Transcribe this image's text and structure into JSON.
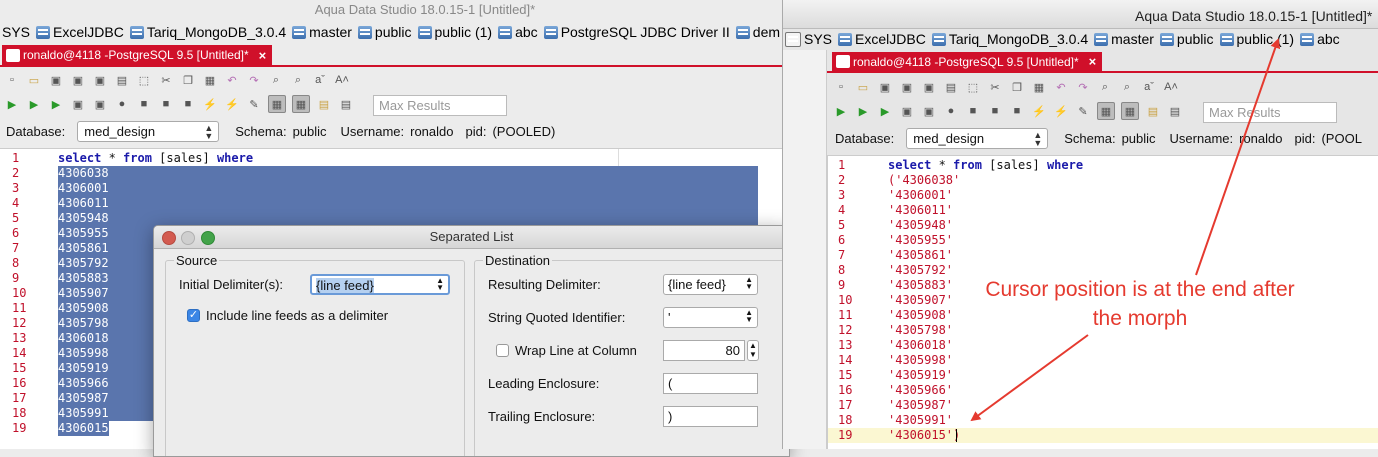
{
  "left": {
    "window_title": "Aqua Data Studio 18.0.15-1 [Untitled]*",
    "connections": [
      {
        "label": "SYS",
        "icon": "none"
      },
      {
        "label": "ExcelJDBC",
        "icon": "database-icon"
      },
      {
        "label": "Tariq_MongoDB_3.0.4",
        "icon": "database-icon"
      },
      {
        "label": "master",
        "icon": "database-icon"
      },
      {
        "label": "public",
        "icon": "database-icon"
      },
      {
        "label": "public (1)",
        "icon": "database-icon"
      },
      {
        "label": "abc",
        "icon": "database-icon"
      },
      {
        "label": "PostgreSQL JDBC Driver II",
        "icon": "database-icon"
      },
      {
        "label": "dem",
        "icon": "database-icon"
      }
    ],
    "editor_tab": "ronaldo@4118 -PostgreSQL 9.5 [Untitled]*",
    "max_results_placeholder": "Max Results",
    "database_label": "Database:",
    "database_value": "med_design",
    "schema_label": "Schema:",
    "schema_value": "public",
    "username_label": "Username:",
    "username_value": "ronaldo",
    "pid_label": "pid:",
    "pid_value": "(POOLED)",
    "lines": [
      {
        "n": "1",
        "text": "select * from [sales] where"
      },
      {
        "n": "2",
        "text": "4306038"
      },
      {
        "n": "3",
        "text": "4306001"
      },
      {
        "n": "4",
        "text": "4306011"
      },
      {
        "n": "5",
        "text": "4305948"
      },
      {
        "n": "6",
        "text": "4305955"
      },
      {
        "n": "7",
        "text": "4305861"
      },
      {
        "n": "8",
        "text": "4305792"
      },
      {
        "n": "9",
        "text": "4305883"
      },
      {
        "n": "10",
        "text": "4305907"
      },
      {
        "n": "11",
        "text": "4305908"
      },
      {
        "n": "12",
        "text": "4305798"
      },
      {
        "n": "13",
        "text": "4306018"
      },
      {
        "n": "14",
        "text": "4305998"
      },
      {
        "n": "15",
        "text": "4305919"
      },
      {
        "n": "16",
        "text": "4305966"
      },
      {
        "n": "17",
        "text": "4305987"
      },
      {
        "n": "18",
        "text": "4305991"
      },
      {
        "n": "19",
        "text": "4306015"
      }
    ]
  },
  "dialog": {
    "title": "Separated List",
    "source_label": "Source",
    "initial_delimiter_label": "Initial Delimiter(s):",
    "initial_delimiter_value": "{line feed}",
    "include_line_feeds_label": "Include line feeds as a delimiter",
    "include_line_feeds_checked": true,
    "destination_label": "Destination",
    "resulting_delimiter_label": "Resulting Delimiter:",
    "resulting_delimiter_value": "{line feed}",
    "string_quoted_label": "String Quoted Identifier:",
    "string_quoted_value": "'",
    "wrap_line_label": "Wrap Line at Column",
    "wrap_line_checked": false,
    "wrap_line_value": "80",
    "leading_enclosure_label": "Leading Enclosure:",
    "leading_enclosure_value": "(",
    "trailing_enclosure_label": "Trailing Enclosure:",
    "trailing_enclosure_value": ")"
  },
  "right": {
    "window_title": "Aqua Data Studio 18.0.15-1 [Untitled]*",
    "connections": [
      {
        "label": "SYS",
        "icon": "none"
      },
      {
        "label": "ExcelJDBC",
        "icon": "database-icon"
      },
      {
        "label": "Tariq_MongoDB_3.0.4",
        "icon": "database-icon"
      },
      {
        "label": "master",
        "icon": "database-icon"
      },
      {
        "label": "public",
        "icon": "database-icon"
      },
      {
        "label": "public (1)",
        "icon": "database-icon"
      },
      {
        "label": "abc",
        "icon": "database-icon"
      }
    ],
    "editor_tab": "ronaldo@4118 -PostgreSQL 9.5 [Untitled]*",
    "max_results_placeholder": "Max Results",
    "database_label": "Database:",
    "database_value": "med_design",
    "schema_label": "Schema:",
    "schema_value": "public",
    "username_label": "Username:",
    "username_value": "ronaldo",
    "pid_label": "pid:",
    "pid_value": "(POOL",
    "lines": [
      {
        "n": "1",
        "text": "select * from [sales] where"
      },
      {
        "n": "2",
        "text": "('4306038'"
      },
      {
        "n": "3",
        "text": "'4306001'"
      },
      {
        "n": "4",
        "text": "'4306011'"
      },
      {
        "n": "5",
        "text": "'4305948'"
      },
      {
        "n": "6",
        "text": "'4305955'"
      },
      {
        "n": "7",
        "text": "'4305861'"
      },
      {
        "n": "8",
        "text": "'4305792'"
      },
      {
        "n": "9",
        "text": "'4305883'"
      },
      {
        "n": "10",
        "text": "'4305907'"
      },
      {
        "n": "11",
        "text": "'4305908'"
      },
      {
        "n": "12",
        "text": "'4305798'"
      },
      {
        "n": "13",
        "text": "'4306018'"
      },
      {
        "n": "14",
        "text": "'4305998'"
      },
      {
        "n": "15",
        "text": "'4305919'"
      },
      {
        "n": "16",
        "text": "'4305966'"
      },
      {
        "n": "17",
        "text": "'4305987'"
      },
      {
        "n": "18",
        "text": "'4305991'"
      },
      {
        "n": "19",
        "text": "'4306015')"
      }
    ]
  },
  "annotation": "Cursor position is at the end after the morph",
  "colors": {
    "accent_red": "#d0102a",
    "selection": "#5a75ad",
    "annotation": "#e53a2f",
    "keyword": "#1a1aaa"
  }
}
